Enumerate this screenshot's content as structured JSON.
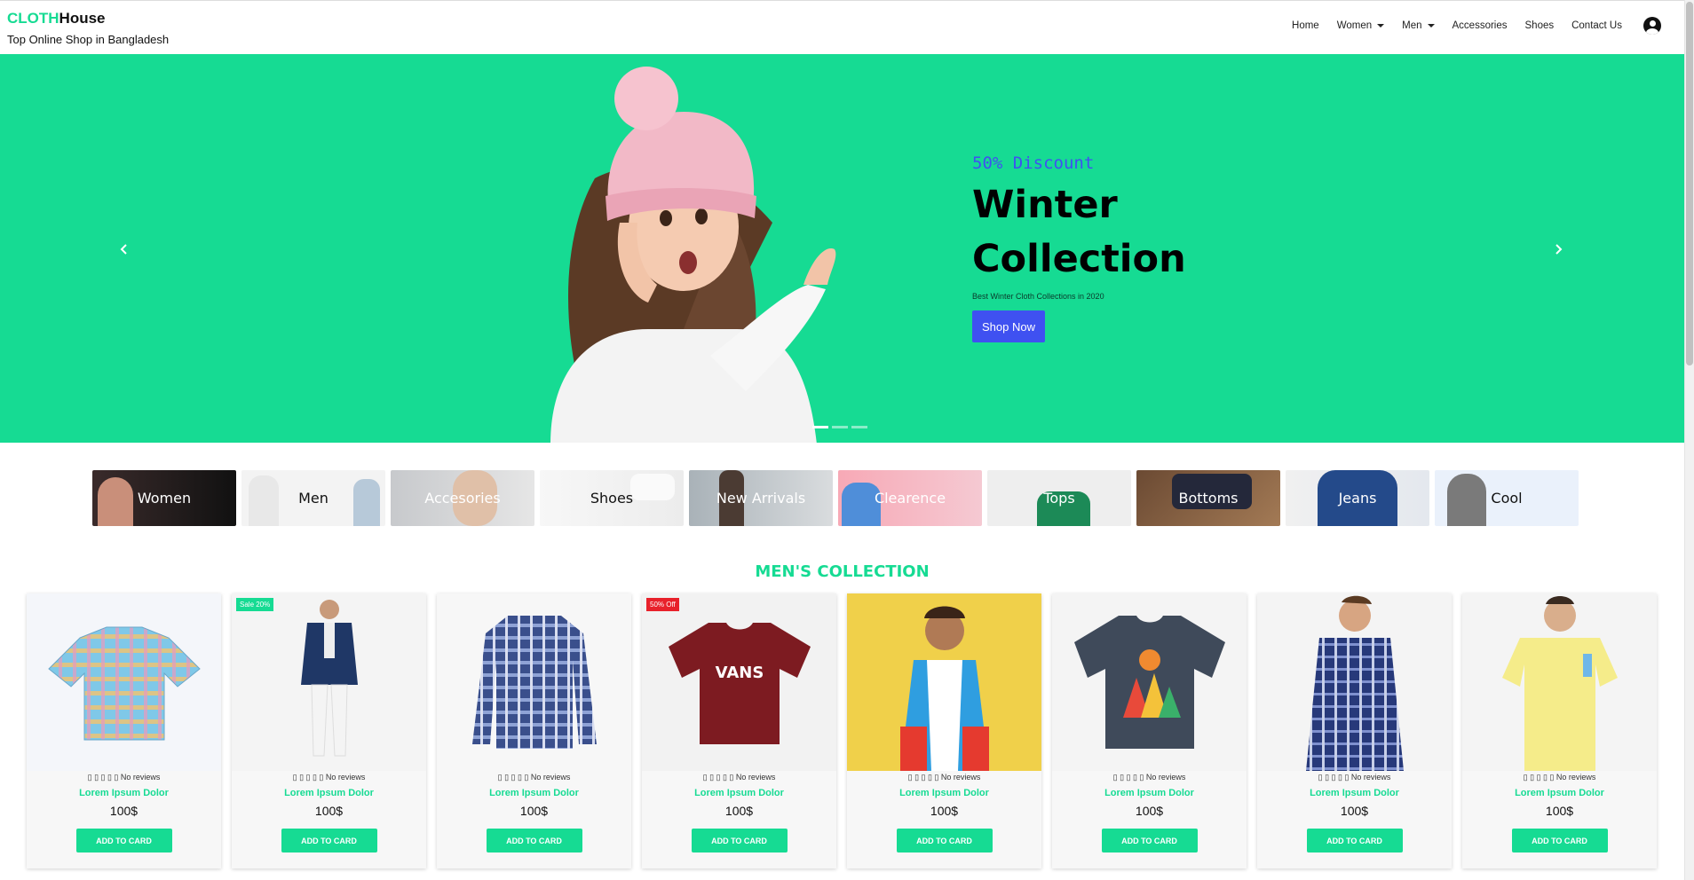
{
  "brand": {
    "part1": "CLOTH",
    "part2": "House",
    "tagline": "Top Online Shop in Bangladesh"
  },
  "nav": {
    "home": "Home",
    "women": "Women",
    "men": "Men",
    "accessories": "Accessories",
    "shoes": "Shoes",
    "contact": "Contact Us"
  },
  "hero": {
    "discount": "50% Discount",
    "title": "Winter Collection",
    "subtitle": "Best Winter Cloth Collections in 2020",
    "button": "Shop Now"
  },
  "categories": [
    {
      "label": "Women",
      "color": "#ffffff"
    },
    {
      "label": "Men",
      "color": "#111111"
    },
    {
      "label": "Accesories",
      "color": "#ffffff"
    },
    {
      "label": "Shoes",
      "color": "#111111"
    },
    {
      "label": "New Arrivals",
      "color": "#ffffff"
    },
    {
      "label": "Clearence",
      "color": "#ffffff"
    },
    {
      "label": "Tops",
      "color": "#ffffff"
    },
    {
      "label": "Bottoms",
      "color": "#ffffff"
    },
    {
      "label": "Jeans",
      "color": "#ffffff"
    },
    {
      "label": "Cool",
      "color": "#111111"
    }
  ],
  "section": {
    "title": "MEN'S COLLECTION"
  },
  "products": [
    {
      "badge": "",
      "rating": "▯ ▯ ▯ ▯ ▯ No reviews",
      "name": "Lorem Ipsum Dolor",
      "price": "100$",
      "button": "ADD TO CARD"
    },
    {
      "badge": "Sale 20%",
      "rating": "▯ ▯ ▯ ▯ ▯ No reviews",
      "name": "Lorem Ipsum Dolor",
      "price": "100$",
      "button": "ADD TO CARD"
    },
    {
      "badge": "",
      "rating": "▯ ▯ ▯ ▯ ▯ No reviews",
      "name": "Lorem Ipsum Dolor",
      "price": "100$",
      "button": "ADD TO CARD"
    },
    {
      "badge": "50% Off",
      "rating": "▯ ▯ ▯ ▯ ▯ No reviews",
      "name": "Lorem Ipsum Dolor",
      "price": "100$",
      "button": "ADD TO CARD"
    },
    {
      "badge": "",
      "rating": "▯ ▯ ▯ ▯ ▯ No reviews",
      "name": "Lorem Ipsum Dolor",
      "price": "100$",
      "button": "ADD TO CARD"
    },
    {
      "badge": "",
      "rating": "▯ ▯ ▯ ▯ ▯ No reviews",
      "name": "Lorem Ipsum Dolor",
      "price": "100$",
      "button": "ADD TO CARD"
    },
    {
      "badge": "",
      "rating": "▯ ▯ ▯ ▯ ▯ No reviews",
      "name": "Lorem Ipsum Dolor",
      "price": "100$",
      "button": "ADD TO CARD"
    },
    {
      "badge": "",
      "rating": "▯ ▯ ▯ ▯ ▯ No reviews",
      "name": "Lorem Ipsum Dolor",
      "price": "100$",
      "button": "ADD TO CARD"
    }
  ],
  "colors": {
    "accent": "#16db93",
    "button_blue": "#3f51f1",
    "sale_badge": "#16db93",
    "off_badge": "#e8212b"
  }
}
